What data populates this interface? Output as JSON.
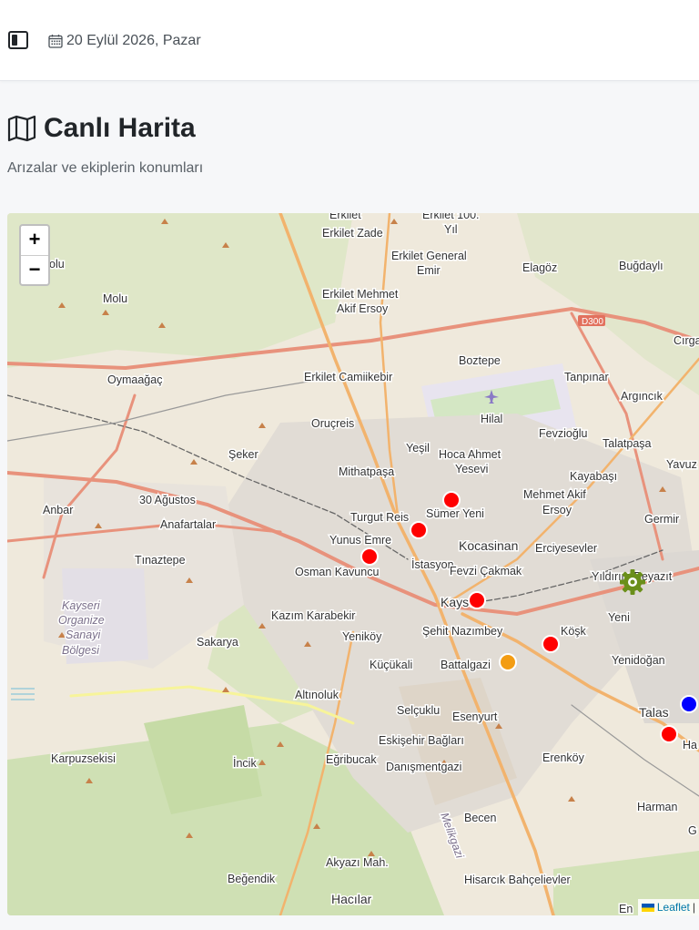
{
  "header": {
    "sidebar_toggle_icon": "sidebar-toggle-icon",
    "calendar_icon": "calendar-icon",
    "date": "20 Eylül 2026, Pazar"
  },
  "page": {
    "title_icon": "map-icon",
    "title": "Canlı Harita",
    "subtitle": "Arızalar ve ekiplerin konumları"
  },
  "map": {
    "zoom_in": "+",
    "zoom_out": "−",
    "attribution": {
      "leaflet": "Leaflet",
      "separator": "|"
    },
    "labels": {
      "erkilet": "Erkilet",
      "erkilet_zade": "Erkilet Zade",
      "erkilet_100_a": "Erkilet 100.",
      "erkilet_100_b": "Yıl",
      "erkilet_general_a": "Erkilet General",
      "erkilet_general_b": "Emir",
      "erkilet_mehmet_a": "Erkilet Mehmet",
      "erkilet_mehmet_b": "Akif Ersoy",
      "elagoz": "Elagöz",
      "bugdayli": "Buğdaylı",
      "molu_top": "olu",
      "molu": "Molu",
      "d300": "D300",
      "cirga": "Cırga",
      "boztepe": "Boztepe",
      "oymaagac": "Oymaağaç",
      "erkilet_camiikebir": "Erkilet Camiikebir",
      "tanpinar": "Tanpınar",
      "argincik": "Argıncık",
      "hilal": "Hilal",
      "orucreis": "Oruçreis",
      "fevzioglu": "Fevzioğlu",
      "yesil": "Yeşil",
      "hoca_ahmet_a": "Hoca Ahmet",
      "hoca_ahmet_b": "Yesevi",
      "talatpasa": "Talatpaşa",
      "seker": "Şeker",
      "mithatpasa": "Mithatpaşa",
      "kayabasi": "Kayabaşı",
      "yavuz": "Yavuz",
      "otuz_agustos": "30 Ağustos",
      "mehmet_akif_a": "Mehmet Akif",
      "mehmet_akif_b": "Ersoy",
      "anbar": "Anbar",
      "turgut_reis": "Turgut Reis",
      "sumer_yeni": "Sümer Yeni",
      "germir": "Germir",
      "anafartalar": "Anafartalar",
      "yunus_emre": "Yunus Emre",
      "kocasinan": "Kocasinan",
      "erciyesevler": "Erciyesevler",
      "tinaztepe": "Tınaztepe",
      "istasyon": "İstasyon",
      "osman_kavuncu": "Osman Kavuncu",
      "fevzi_cakmak": "Fevzi Çakmak",
      "yildirim_beyazit": "Yıldırım Beyazıt",
      "kayseri": "Kayseri",
      "kayseri_osb_1": "Kayseri",
      "kayseri_osb_2": "Organize",
      "kayseri_osb_3": "Sanayi",
      "kayseri_osb_4": "Bölgesi",
      "kazim_karabekir": "Kazım Karabekir",
      "yeni": "Yeni",
      "sehit_nazimbey": "Şehit Nazımbey",
      "kosk": "Köşk",
      "sakarya": "Sakarya",
      "yenikoy": "Yeniköy",
      "yenidogan": "Yenidoğan",
      "kucukali": "Küçükali",
      "battalgazi": "Battalgazi",
      "altinoluk": "Altınoluk",
      "talas": "Talas",
      "selcuklu": "Selçuklu",
      "esenyurt": "Esenyurt",
      "eskisehir_baglari": "Eskişehir Bağları",
      "karpuzsekisi": "Karpuzsekisi",
      "erenkoy": "Erenköy",
      "incik": "İncik",
      "egribucak": "Eğribucak",
      "danismentgazi": "Danışmentgazi",
      "harman": "Harman",
      "becen": "Becen",
      "akyazi_mah": "Akyazı Mah.",
      "begendik": "Beğendik",
      "hisarcik": "Hisarcık Bahçelievler",
      "hacilar": "Hacılar",
      "melikgazi": "Melikgazi",
      "ha_edge": "Ha",
      "en_edge": "En",
      "g_edge": "G"
    },
    "markers": [
      {
        "type": "fault",
        "color": "#ff0000"
      },
      {
        "type": "fault",
        "color": "#ff0000"
      },
      {
        "type": "fault",
        "color": "#ff0000"
      },
      {
        "type": "fault",
        "color": "#ff0000"
      },
      {
        "type": "fault",
        "color": "#ff0000"
      },
      {
        "type": "fault",
        "color": "#ff0000"
      },
      {
        "type": "fault-pending",
        "color": "#f39c12"
      },
      {
        "type": "team",
        "color": "#0000ff"
      },
      {
        "type": "depot",
        "color": "#6a8f1a",
        "icon": "gear-icon"
      }
    ]
  }
}
